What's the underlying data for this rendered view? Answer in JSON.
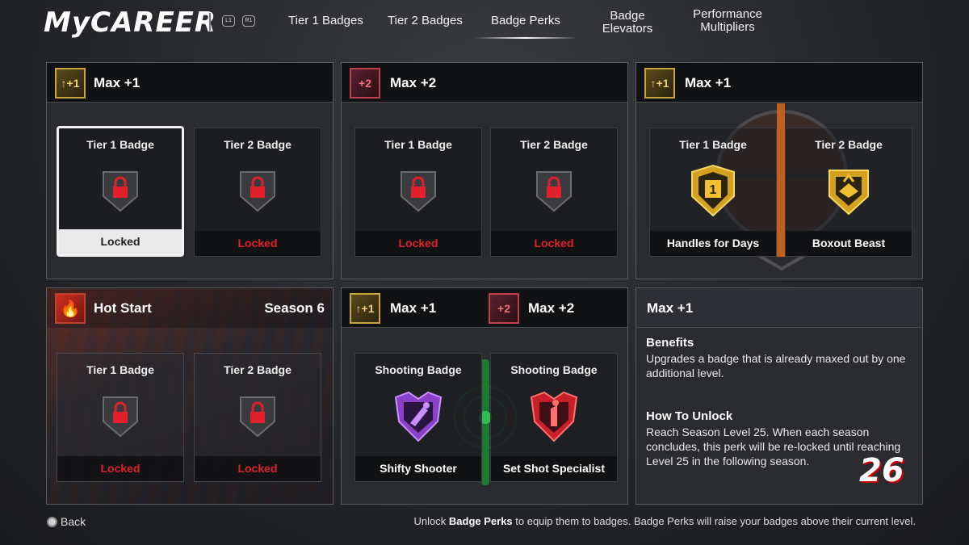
{
  "header": {
    "logo": "MyCAREER",
    "hints": [
      "L1",
      "R1"
    ],
    "tabs": [
      {
        "label": "Tier 1 Badges"
      },
      {
        "label": "Tier 2 Badges"
      },
      {
        "label": "Badge Perks",
        "active": true
      },
      {
        "label_line1": "Badge",
        "label_line2": "Elevators"
      },
      {
        "label_line1": "Performance",
        "label_line2": "Multipliers"
      }
    ]
  },
  "panels": [
    {
      "title": "Max +1",
      "icon": "max-plus-1-icon",
      "slots": [
        {
          "title": "Tier 1 Badge",
          "status": "Locked",
          "selected": true
        },
        {
          "title": "Tier 2 Badge",
          "status": "Locked"
        }
      ]
    },
    {
      "title": "Max +2",
      "icon": "max-plus-2-icon",
      "slots": [
        {
          "title": "Tier 1 Badge",
          "status": "Locked"
        },
        {
          "title": "Tier 2 Badge",
          "status": "Locked"
        }
      ]
    },
    {
      "title": "Max +1",
      "icon": "max-plus-1-icon",
      "slots": [
        {
          "title": "Tier 1 Badge",
          "badge": "Handles for Days",
          "badge_icon": "handles-badge-icon",
          "badge_level": "1"
        },
        {
          "title": "Tier 2 Badge",
          "badge": "Boxout Beast",
          "badge_icon": "boxout-badge-icon"
        }
      ]
    },
    {
      "title": "Hot Start",
      "season": "Season 6",
      "icon": "fire-icon",
      "slots": [
        {
          "title": "Tier 1 Badge",
          "status": "Locked"
        },
        {
          "title": "Tier 2 Badge",
          "status": "Locked"
        }
      ]
    },
    {
      "title_a": "Max +1",
      "title_b": "Max +2",
      "slots": [
        {
          "title": "Shooting Badge",
          "badge": "Shifty Shooter",
          "badge_icon": "shifty-shooter-icon"
        },
        {
          "title": "Shooting Badge",
          "badge": "Set Shot Specialist",
          "badge_icon": "set-shot-specialist-icon"
        }
      ]
    }
  ],
  "info": {
    "title": "Max +1",
    "benefits_heading": "Benefits",
    "benefits_text": "Upgrades a badge that is already maxed out by one additional level.",
    "unlock_heading": "How To Unlock",
    "unlock_text": "Reach Season Level 25. When each season concludes, this perk will be re-locked until reaching Level 25 in the following season."
  },
  "footer": {
    "back_label": "Back",
    "hint_prefix": "Unlock ",
    "hint_bold": "Badge Perks",
    "hint_suffix": " to equip them to badges. Badge Perks will raise your badges above their current level.",
    "game_logo": "26"
  },
  "colors": {
    "locked": "#e0202a",
    "accent_gold": "#c9a53a",
    "accent_red": "#c04050"
  }
}
